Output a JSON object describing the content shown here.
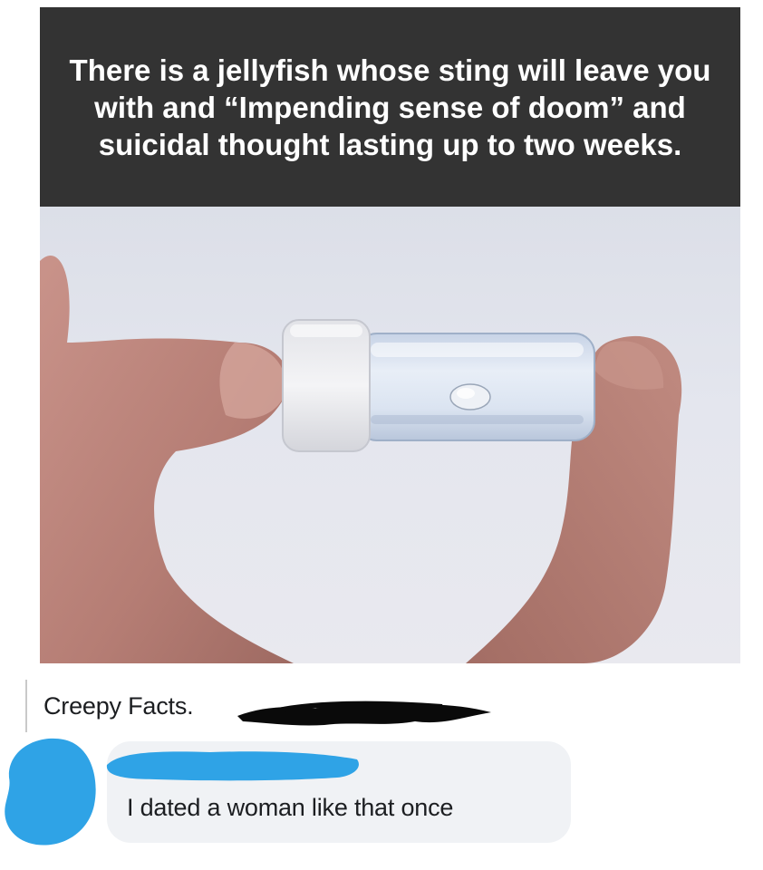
{
  "caption": {
    "text": "There is a jellyfish whose sting will leave you with and “Impending sense of doom” and suicidal thought lasting up to two weeks."
  },
  "photo": {
    "subject": "hand-holding-vial-photo"
  },
  "post": {
    "page_name": "Creepy Facts."
  },
  "comment": {
    "text": "I dated a woman like that once"
  },
  "colors": {
    "caption_bg": "#333333",
    "caption_text": "#ffffff",
    "bubble_bg": "#f0f2f5",
    "scribble_blue": "#2fa3e6",
    "redaction_black": "#0a0a0a"
  }
}
